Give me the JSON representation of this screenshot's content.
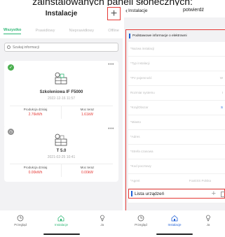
{
  "caption": "zainstalowanych paneli słonecznych:",
  "left": {
    "title": "Instalacje",
    "tabs": [
      {
        "label": "Wszystko",
        "active": true
      },
      {
        "label": "Prawidłowy",
        "active": false
      },
      {
        "label": "Nieprawidłowy",
        "active": false
      },
      {
        "label": "Offline",
        "active": false
      }
    ],
    "search_placeholder": "Szukaj informacji",
    "cards": [
      {
        "status": "ok",
        "name": "Szkoleniowa IF F5000",
        "date": "2022-12-16 11:57",
        "labels": [
          "Produkcja dzisiaj",
          "Moc teraz"
        ],
        "values": [
          "2.76kWh",
          "1.61kW"
        ]
      },
      {
        "status": "offline",
        "name": "T 5.0",
        "date": "2021-02-25 10:41",
        "labels": [
          "Produkcja dzisiaj",
          "Moc teraz"
        ],
        "values": [
          "0.00kWh",
          "0.00kW"
        ]
      }
    ],
    "nav": [
      "Przegląd",
      "Instalacje",
      "Ja"
    ]
  },
  "right": {
    "back_label": "Instalacje",
    "title": "potwierdź",
    "section_title": "Podstawowe informacje o elektrowni",
    "fields": [
      {
        "label": "*Nazwa instalacji",
        "value": ""
      },
      {
        "label": "*Typ instalacji",
        "value": ""
      },
      {
        "label": "*PV pojemność",
        "value": "W"
      },
      {
        "label": "Rozmiar systemu",
        "value": "I"
      },
      {
        "label": "*Kraj/Obszar",
        "value": "S"
      },
      {
        "label": "*Miasto",
        "value": ""
      },
      {
        "label": "*Adres",
        "value": ""
      },
      {
        "label": "*Strefa czasowa",
        "value": ""
      },
      {
        "label": "*Kod pocztowy",
        "value": ""
      },
      {
        "label": "*Agent",
        "value": "FoxESS Polska"
      },
      {
        "label": "Czas sieci",
        "value": ""
      }
    ],
    "devices_label": "Lista urządzeń",
    "nav": [
      "Przegląd",
      "Instalacje",
      "Ja"
    ]
  },
  "colors": {
    "accent": "#2bb673",
    "highlight": "#e53935",
    "blue": "#1e5fd6"
  }
}
